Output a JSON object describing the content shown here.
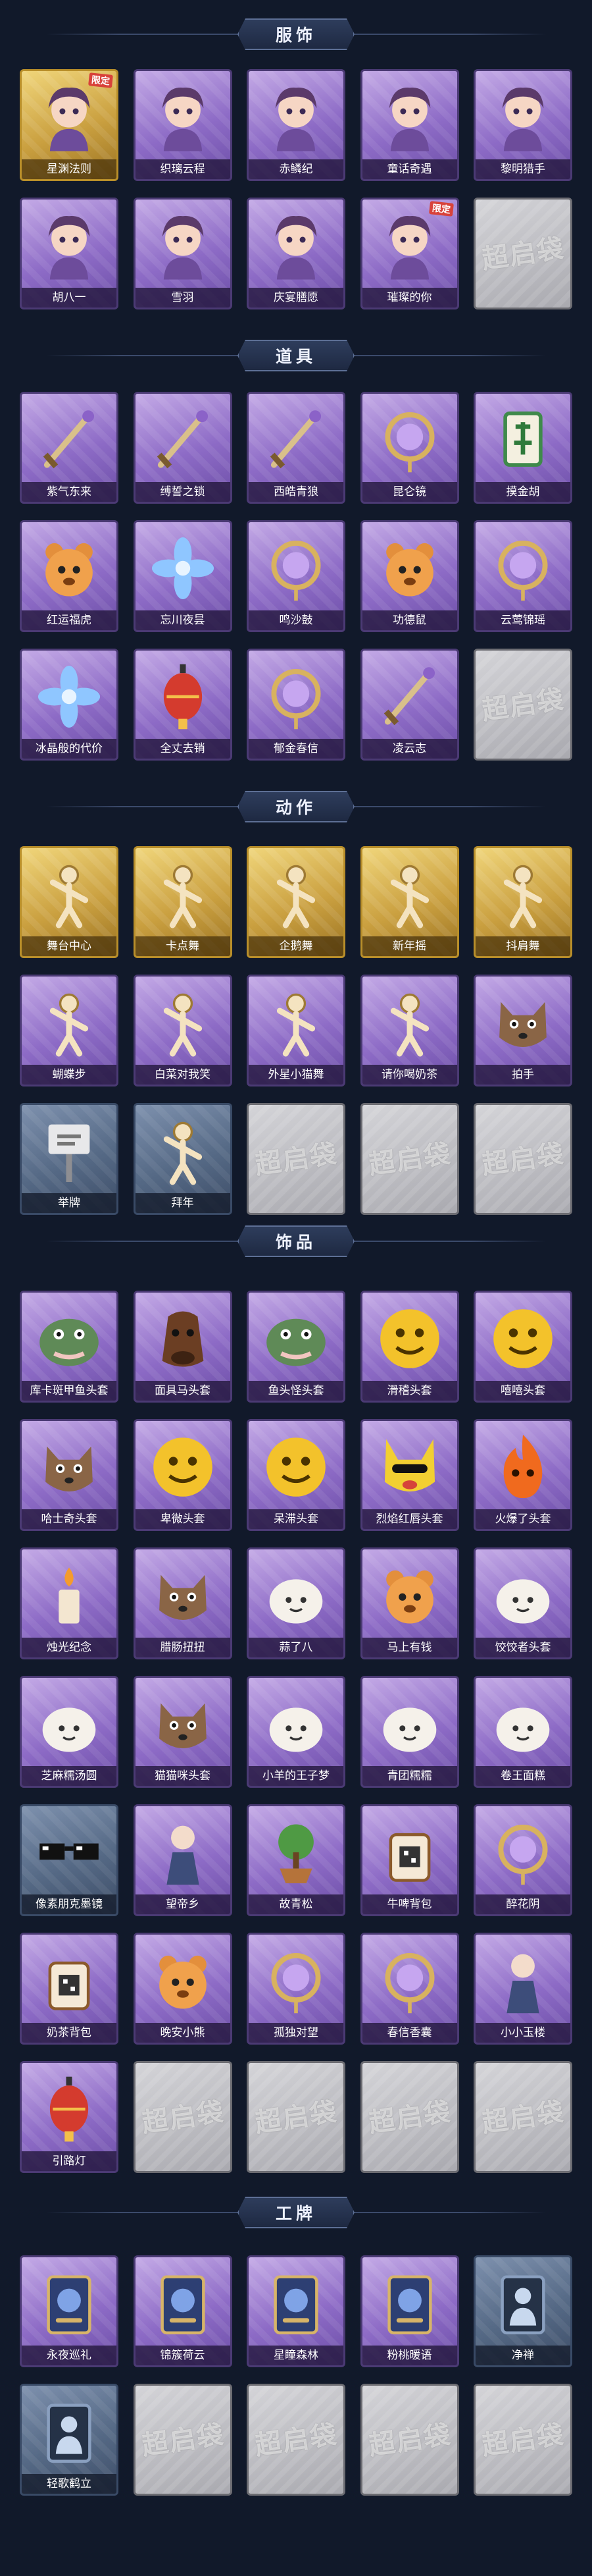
{
  "placeholder_text": "超启袋",
  "colors": {
    "page_bg": "#11192a",
    "purple_card": "#8d6bc6",
    "gold_card": "#caa040",
    "blue_card": "#556985",
    "empty_card": "#bdbdc2",
    "header_plate": "#2e3d5c"
  },
  "sections": [
    {
      "title": "服饰",
      "items": [
        {
          "label": "星渊法则",
          "tier": "gold",
          "badge": "限定",
          "icon": "character-portrait-icon"
        },
        {
          "label": "织璃云程",
          "tier": "purple",
          "badge": "",
          "icon": "character-portrait-icon"
        },
        {
          "label": "赤鳞纪",
          "tier": "purple",
          "badge": "",
          "icon": "character-portrait-icon"
        },
        {
          "label": "童话奇遇",
          "tier": "purple",
          "badge": "",
          "icon": "character-portrait-icon"
        },
        {
          "label": "黎明猎手",
          "tier": "purple",
          "badge": "",
          "icon": "character-portrait-icon"
        },
        {
          "label": "胡八一",
          "tier": "purple",
          "badge": "",
          "icon": "character-portrait-icon"
        },
        {
          "label": "雪羽",
          "tier": "purple",
          "badge": "",
          "icon": "character-portrait-icon"
        },
        {
          "label": "庆宴膳愿",
          "tier": "purple",
          "badge": "",
          "icon": "character-portrait-icon"
        },
        {
          "label": "璀璨的你",
          "tier": "purple",
          "badge": "限定",
          "icon": "character-portrait-icon"
        },
        {
          "label": "",
          "tier": "empty",
          "badge": "",
          "icon": ""
        }
      ]
    },
    {
      "title": "道具",
      "items": [
        {
          "label": "紫气东来",
          "tier": "purple",
          "badge": "",
          "icon": "blade-icon"
        },
        {
          "label": "缚誓之锁",
          "tier": "purple",
          "badge": "",
          "icon": "chain-icon"
        },
        {
          "label": "西皓青狼",
          "tier": "purple",
          "badge": "",
          "icon": "staff-icon"
        },
        {
          "label": "昆仑镜",
          "tier": "purple",
          "badge": "",
          "icon": "mirror-icon"
        },
        {
          "label": "摸金胡",
          "tier": "purple",
          "badge": "",
          "icon": "mahjong-tile-icon"
        },
        {
          "label": "红运福虎",
          "tier": "purple",
          "badge": "",
          "icon": "tiger-icon"
        },
        {
          "label": "忘川夜昙",
          "tier": "purple",
          "badge": "",
          "icon": "flower-icon"
        },
        {
          "label": "鸣沙鼓",
          "tier": "purple",
          "badge": "",
          "icon": "drum-icon"
        },
        {
          "label": "功德鼠",
          "tier": "purple",
          "badge": "",
          "icon": "mouse-icon"
        },
        {
          "label": "云莺锦瑶",
          "tier": "purple",
          "badge": "",
          "icon": "ornament-icon"
        },
        {
          "label": "冰晶般的代价",
          "tier": "purple",
          "badge": "",
          "icon": "ice-lotus-icon"
        },
        {
          "label": "全丈去销",
          "tier": "purple",
          "badge": "",
          "icon": "lantern-icon"
        },
        {
          "label": "郁金春信",
          "tier": "purple",
          "badge": "",
          "icon": "fan-icon"
        },
        {
          "label": "凌云志",
          "tier": "purple",
          "badge": "",
          "icon": "bow-icon"
        },
        {
          "label": "",
          "tier": "empty",
          "badge": "",
          "icon": ""
        }
      ]
    },
    {
      "title": "动作",
      "items": [
        {
          "label": "舞台中心",
          "tier": "gold",
          "badge": "",
          "icon": "pose-icon"
        },
        {
          "label": "卡点舞",
          "tier": "gold",
          "badge": "",
          "icon": "pose-icon"
        },
        {
          "label": "企鹅舞",
          "tier": "gold",
          "badge": "",
          "icon": "pose-icon"
        },
        {
          "label": "新年摇",
          "tier": "gold",
          "badge": "",
          "icon": "pose-icon"
        },
        {
          "label": "抖肩舞",
          "tier": "gold",
          "badge": "",
          "icon": "pose-icon"
        },
        {
          "label": "蝴蝶步",
          "tier": "purple",
          "badge": "",
          "icon": "pose-icon"
        },
        {
          "label": "白菜对我笑",
          "tier": "purple",
          "badge": "",
          "icon": "pose-icon"
        },
        {
          "label": "外星小猫舞",
          "tier": "purple",
          "badge": "",
          "icon": "pose-icon"
        },
        {
          "label": "请你喝奶茶",
          "tier": "purple",
          "badge": "",
          "icon": "pose-icon"
        },
        {
          "label": "拍手",
          "tier": "purple",
          "badge": "",
          "icon": "cat-icon"
        },
        {
          "label": "举牌",
          "tier": "blue",
          "badge": "",
          "icon": "sign-icon"
        },
        {
          "label": "拜年",
          "tier": "blue",
          "badge": "",
          "icon": "pose-icon"
        },
        {
          "label": "",
          "tier": "empty",
          "badge": "",
          "icon": ""
        },
        {
          "label": "",
          "tier": "empty",
          "badge": "",
          "icon": ""
        },
        {
          "label": "",
          "tier": "empty",
          "badge": "",
          "icon": ""
        }
      ]
    },
    {
      "title": "饰品",
      "items": [
        {
          "label": "库卡斑甲鱼头套",
          "tier": "purple",
          "badge": "",
          "icon": "fish-head-icon"
        },
        {
          "label": "面具马头套",
          "tier": "purple",
          "badge": "",
          "icon": "horse-head-icon"
        },
        {
          "label": "鱼头怪头套",
          "tier": "purple",
          "badge": "",
          "icon": "fish-head-icon"
        },
        {
          "label": "滑稽头套",
          "tier": "purple",
          "badge": "",
          "icon": "emoji-face-icon"
        },
        {
          "label": "嘻嘻头套",
          "tier": "purple",
          "badge": "",
          "icon": "emoji-face-icon"
        },
        {
          "label": "哈士奇头套",
          "tier": "purple",
          "badge": "",
          "icon": "dog-head-icon"
        },
        {
          "label": "卑微头套",
          "tier": "purple",
          "badge": "",
          "icon": "emoji-face-icon"
        },
        {
          "label": "呆滞头套",
          "tier": "purple",
          "badge": "",
          "icon": "emoji-face-icon"
        },
        {
          "label": "烈焰红唇头套",
          "tier": "purple",
          "badge": "",
          "icon": "pikachu-head-icon"
        },
        {
          "label": "火爆了头套",
          "tier": "purple",
          "badge": "",
          "icon": "flame-face-icon"
        },
        {
          "label": "烛光纪念",
          "tier": "purple",
          "badge": "",
          "icon": "candle-icon"
        },
        {
          "label": "腊肠扭扭",
          "tier": "purple",
          "badge": "",
          "icon": "dog-icon"
        },
        {
          "label": "蒜了八",
          "tier": "purple",
          "badge": "",
          "icon": "garlic-icon"
        },
        {
          "label": "马上有钱",
          "tier": "purple",
          "badge": "",
          "icon": "pony-icon"
        },
        {
          "label": "饺饺者头套",
          "tier": "purple",
          "badge": "",
          "icon": "dumpling-icon"
        },
        {
          "label": "芝麻糯汤圆",
          "tier": "purple",
          "badge": "",
          "icon": "tangyuan-icon"
        },
        {
          "label": "猫猫咪头套",
          "tier": "purple",
          "badge": "",
          "icon": "cat-head-icon"
        },
        {
          "label": "小羊的王子梦",
          "tier": "purple",
          "badge": "",
          "icon": "sheep-icon"
        },
        {
          "label": "青团糯糯",
          "tier": "purple",
          "badge": "",
          "icon": "green-dumpling-icon"
        },
        {
          "label": "卷王面糕",
          "tier": "purple",
          "badge": "",
          "icon": "cake-roll-icon"
        },
        {
          "label": "像素朋克墨镜",
          "tier": "blue",
          "badge": "",
          "icon": "sunglasses-icon"
        },
        {
          "label": "望帝乡",
          "tier": "purple",
          "badge": "",
          "icon": "figure-icon"
        },
        {
          "label": "故青松",
          "tier": "purple",
          "badge": "",
          "icon": "bonsai-icon"
        },
        {
          "label": "牛啤背包",
          "tier": "purple",
          "badge": "",
          "icon": "mug-backpack-icon"
        },
        {
          "label": "醉花阴",
          "tier": "purple",
          "badge": "",
          "icon": "ornament-icon"
        },
        {
          "label": "奶茶背包",
          "tier": "purple",
          "badge": "",
          "icon": "qr-bag-icon"
        },
        {
          "label": "晚安小熊",
          "tier": "purple",
          "badge": "",
          "icon": "bear-icon"
        },
        {
          "label": "孤独对望",
          "tier": "purple",
          "badge": "",
          "icon": "pendant-icon"
        },
        {
          "label": "春信香囊",
          "tier": "purple",
          "badge": "",
          "icon": "sachet-icon"
        },
        {
          "label": "小小玉楼",
          "tier": "purple",
          "badge": "",
          "icon": "doll-icon"
        },
        {
          "label": "引路灯",
          "tier": "purple",
          "badge": "",
          "icon": "lantern-icon"
        },
        {
          "label": "",
          "tier": "empty",
          "badge": "",
          "icon": ""
        },
        {
          "label": "",
          "tier": "empty",
          "badge": "",
          "icon": ""
        },
        {
          "label": "",
          "tier": "empty",
          "badge": "",
          "icon": ""
        },
        {
          "label": "",
          "tier": "empty",
          "badge": "",
          "icon": ""
        }
      ]
    },
    {
      "title": "工牌",
      "items": [
        {
          "label": "永夜巡礼",
          "tier": "purple",
          "badge": "",
          "icon": "badge-card-icon"
        },
        {
          "label": "锦簇荷云",
          "tier": "purple",
          "badge": "",
          "icon": "badge-card-icon"
        },
        {
          "label": "星瞳森林",
          "tier": "purple",
          "badge": "",
          "icon": "badge-card-icon"
        },
        {
          "label": "粉桃暖语",
          "tier": "purple",
          "badge": "",
          "icon": "badge-card-icon"
        },
        {
          "label": "净禅",
          "tier": "blue",
          "badge": "",
          "icon": "silhouette-card-icon"
        },
        {
          "label": "轻歌鹤立",
          "tier": "blue",
          "badge": "",
          "icon": "silhouette-card-icon"
        },
        {
          "label": "",
          "tier": "empty",
          "badge": "",
          "icon": ""
        },
        {
          "label": "",
          "tier": "empty",
          "badge": "",
          "icon": ""
        },
        {
          "label": "",
          "tier": "empty",
          "badge": "",
          "icon": ""
        },
        {
          "label": "",
          "tier": "empty",
          "badge": "",
          "icon": ""
        }
      ]
    }
  ]
}
